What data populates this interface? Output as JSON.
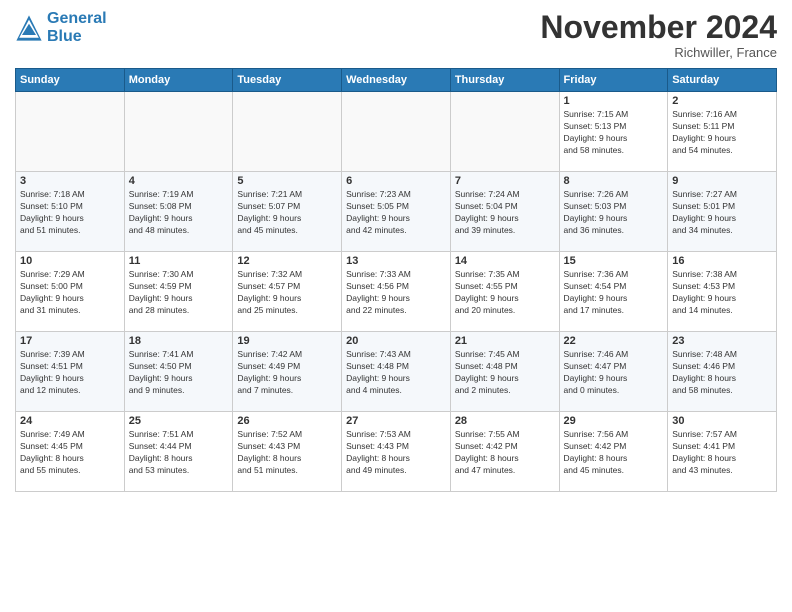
{
  "logo": {
    "line1": "General",
    "line2": "Blue"
  },
  "title": "November 2024",
  "location": "Richwiller, France",
  "weekdays": [
    "Sunday",
    "Monday",
    "Tuesday",
    "Wednesday",
    "Thursday",
    "Friday",
    "Saturday"
  ],
  "weeks": [
    [
      {
        "day": "",
        "info": ""
      },
      {
        "day": "",
        "info": ""
      },
      {
        "day": "",
        "info": ""
      },
      {
        "day": "",
        "info": ""
      },
      {
        "day": "",
        "info": ""
      },
      {
        "day": "1",
        "info": "Sunrise: 7:15 AM\nSunset: 5:13 PM\nDaylight: 9 hours\nand 58 minutes."
      },
      {
        "day": "2",
        "info": "Sunrise: 7:16 AM\nSunset: 5:11 PM\nDaylight: 9 hours\nand 54 minutes."
      }
    ],
    [
      {
        "day": "3",
        "info": "Sunrise: 7:18 AM\nSunset: 5:10 PM\nDaylight: 9 hours\nand 51 minutes."
      },
      {
        "day": "4",
        "info": "Sunrise: 7:19 AM\nSunset: 5:08 PM\nDaylight: 9 hours\nand 48 minutes."
      },
      {
        "day": "5",
        "info": "Sunrise: 7:21 AM\nSunset: 5:07 PM\nDaylight: 9 hours\nand 45 minutes."
      },
      {
        "day": "6",
        "info": "Sunrise: 7:23 AM\nSunset: 5:05 PM\nDaylight: 9 hours\nand 42 minutes."
      },
      {
        "day": "7",
        "info": "Sunrise: 7:24 AM\nSunset: 5:04 PM\nDaylight: 9 hours\nand 39 minutes."
      },
      {
        "day": "8",
        "info": "Sunrise: 7:26 AM\nSunset: 5:03 PM\nDaylight: 9 hours\nand 36 minutes."
      },
      {
        "day": "9",
        "info": "Sunrise: 7:27 AM\nSunset: 5:01 PM\nDaylight: 9 hours\nand 34 minutes."
      }
    ],
    [
      {
        "day": "10",
        "info": "Sunrise: 7:29 AM\nSunset: 5:00 PM\nDaylight: 9 hours\nand 31 minutes."
      },
      {
        "day": "11",
        "info": "Sunrise: 7:30 AM\nSunset: 4:59 PM\nDaylight: 9 hours\nand 28 minutes."
      },
      {
        "day": "12",
        "info": "Sunrise: 7:32 AM\nSunset: 4:57 PM\nDaylight: 9 hours\nand 25 minutes."
      },
      {
        "day": "13",
        "info": "Sunrise: 7:33 AM\nSunset: 4:56 PM\nDaylight: 9 hours\nand 22 minutes."
      },
      {
        "day": "14",
        "info": "Sunrise: 7:35 AM\nSunset: 4:55 PM\nDaylight: 9 hours\nand 20 minutes."
      },
      {
        "day": "15",
        "info": "Sunrise: 7:36 AM\nSunset: 4:54 PM\nDaylight: 9 hours\nand 17 minutes."
      },
      {
        "day": "16",
        "info": "Sunrise: 7:38 AM\nSunset: 4:53 PM\nDaylight: 9 hours\nand 14 minutes."
      }
    ],
    [
      {
        "day": "17",
        "info": "Sunrise: 7:39 AM\nSunset: 4:51 PM\nDaylight: 9 hours\nand 12 minutes."
      },
      {
        "day": "18",
        "info": "Sunrise: 7:41 AM\nSunset: 4:50 PM\nDaylight: 9 hours\nand 9 minutes."
      },
      {
        "day": "19",
        "info": "Sunrise: 7:42 AM\nSunset: 4:49 PM\nDaylight: 9 hours\nand 7 minutes."
      },
      {
        "day": "20",
        "info": "Sunrise: 7:43 AM\nSunset: 4:48 PM\nDaylight: 9 hours\nand 4 minutes."
      },
      {
        "day": "21",
        "info": "Sunrise: 7:45 AM\nSunset: 4:48 PM\nDaylight: 9 hours\nand 2 minutes."
      },
      {
        "day": "22",
        "info": "Sunrise: 7:46 AM\nSunset: 4:47 PM\nDaylight: 9 hours\nand 0 minutes."
      },
      {
        "day": "23",
        "info": "Sunrise: 7:48 AM\nSunset: 4:46 PM\nDaylight: 8 hours\nand 58 minutes."
      }
    ],
    [
      {
        "day": "24",
        "info": "Sunrise: 7:49 AM\nSunset: 4:45 PM\nDaylight: 8 hours\nand 55 minutes."
      },
      {
        "day": "25",
        "info": "Sunrise: 7:51 AM\nSunset: 4:44 PM\nDaylight: 8 hours\nand 53 minutes."
      },
      {
        "day": "26",
        "info": "Sunrise: 7:52 AM\nSunset: 4:43 PM\nDaylight: 8 hours\nand 51 minutes."
      },
      {
        "day": "27",
        "info": "Sunrise: 7:53 AM\nSunset: 4:43 PM\nDaylight: 8 hours\nand 49 minutes."
      },
      {
        "day": "28",
        "info": "Sunrise: 7:55 AM\nSunset: 4:42 PM\nDaylight: 8 hours\nand 47 minutes."
      },
      {
        "day": "29",
        "info": "Sunrise: 7:56 AM\nSunset: 4:42 PM\nDaylight: 8 hours\nand 45 minutes."
      },
      {
        "day": "30",
        "info": "Sunrise: 7:57 AM\nSunset: 4:41 PM\nDaylight: 8 hours\nand 43 minutes."
      }
    ]
  ]
}
